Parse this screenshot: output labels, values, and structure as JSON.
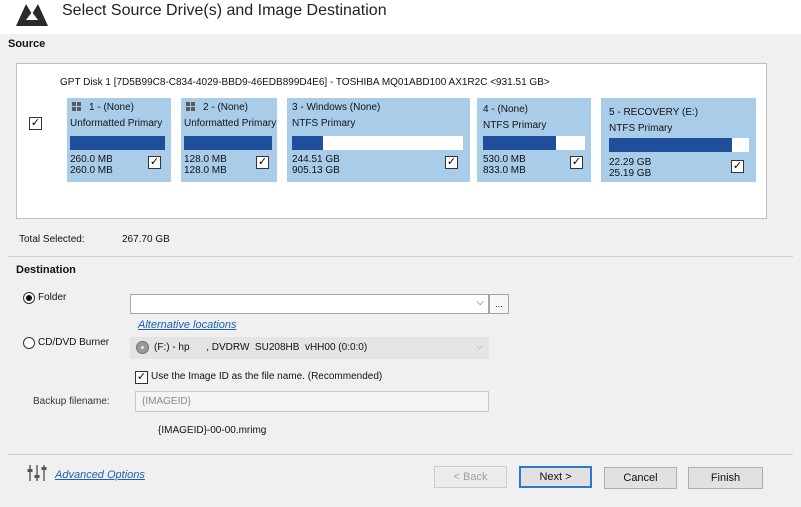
{
  "dialog": {
    "title": "Select Source Drive(s) and Image Destination"
  },
  "source": {
    "heading": "Source",
    "disk_label": "GPT Disk 1 [7D5B99C8-C834-4029-BBD9-46EDB899D4E6] - TOSHIBA MQ01ABD100 AX1R2C  <931.51 GB>",
    "disk_checked": true,
    "partitions": [
      {
        "title": "1 - (None)",
        "type": "Unformatted Primary",
        "used": "260.0 MB",
        "total": "260.0 MB",
        "used_fraction": 1.0,
        "checked": true,
        "windows_icon": true
      },
      {
        "title": "2 - (None)",
        "type": "Unformatted Primary",
        "used": "128.0 MB",
        "total": "128.0 MB",
        "used_fraction": 1.0,
        "checked": true,
        "windows_icon": true
      },
      {
        "title": "3 - Windows (None)",
        "type": "NTFS Primary",
        "used": "244.51 GB",
        "total": "905.13 GB",
        "used_fraction": 0.18,
        "checked": true,
        "windows_icon": false
      },
      {
        "title": "4 - (None)",
        "type": "NTFS Primary",
        "used": "530.0 MB",
        "total": "833.0 MB",
        "used_fraction": 0.72,
        "checked": true,
        "windows_icon": false
      },
      {
        "title": "5 - RECOVERY (E:)",
        "type": "NTFS Primary",
        "used": "22.29 GB",
        "total": "25.19 GB",
        "used_fraction": 0.88,
        "checked": true,
        "windows_icon": false
      }
    ],
    "total_label": "Total Selected:",
    "total_value": "267.70 GB"
  },
  "destination": {
    "heading": "Destination",
    "folder_label": "Folder",
    "folder_value": "",
    "browse_label": "...",
    "alt_locations": "Alternative locations",
    "burner_label": "CD/DVD Burner",
    "burner_value": "(F:) - hp      , DVDRW  SU208HB  vHH00 (0:0:0)",
    "imageid_checkbox_label": "Use the Image ID as the file name.  (Recommended)",
    "imageid_checked": true,
    "backup_filename_label": "Backup filename:",
    "backup_filename_value": "{IMAGEID}",
    "filename_preview": "{IMAGEID}-00-00.mrimg"
  },
  "footer": {
    "advanced_options": "Advanced Options",
    "back": "< Back",
    "next": "Next >",
    "cancel": "Cancel",
    "finish": "Finish"
  },
  "colors": {
    "partition_bg": "#a9cde9",
    "usage_fill": "#1f4e9a",
    "link": "#1a5fb4",
    "default_button_border": "#2a79d4"
  }
}
